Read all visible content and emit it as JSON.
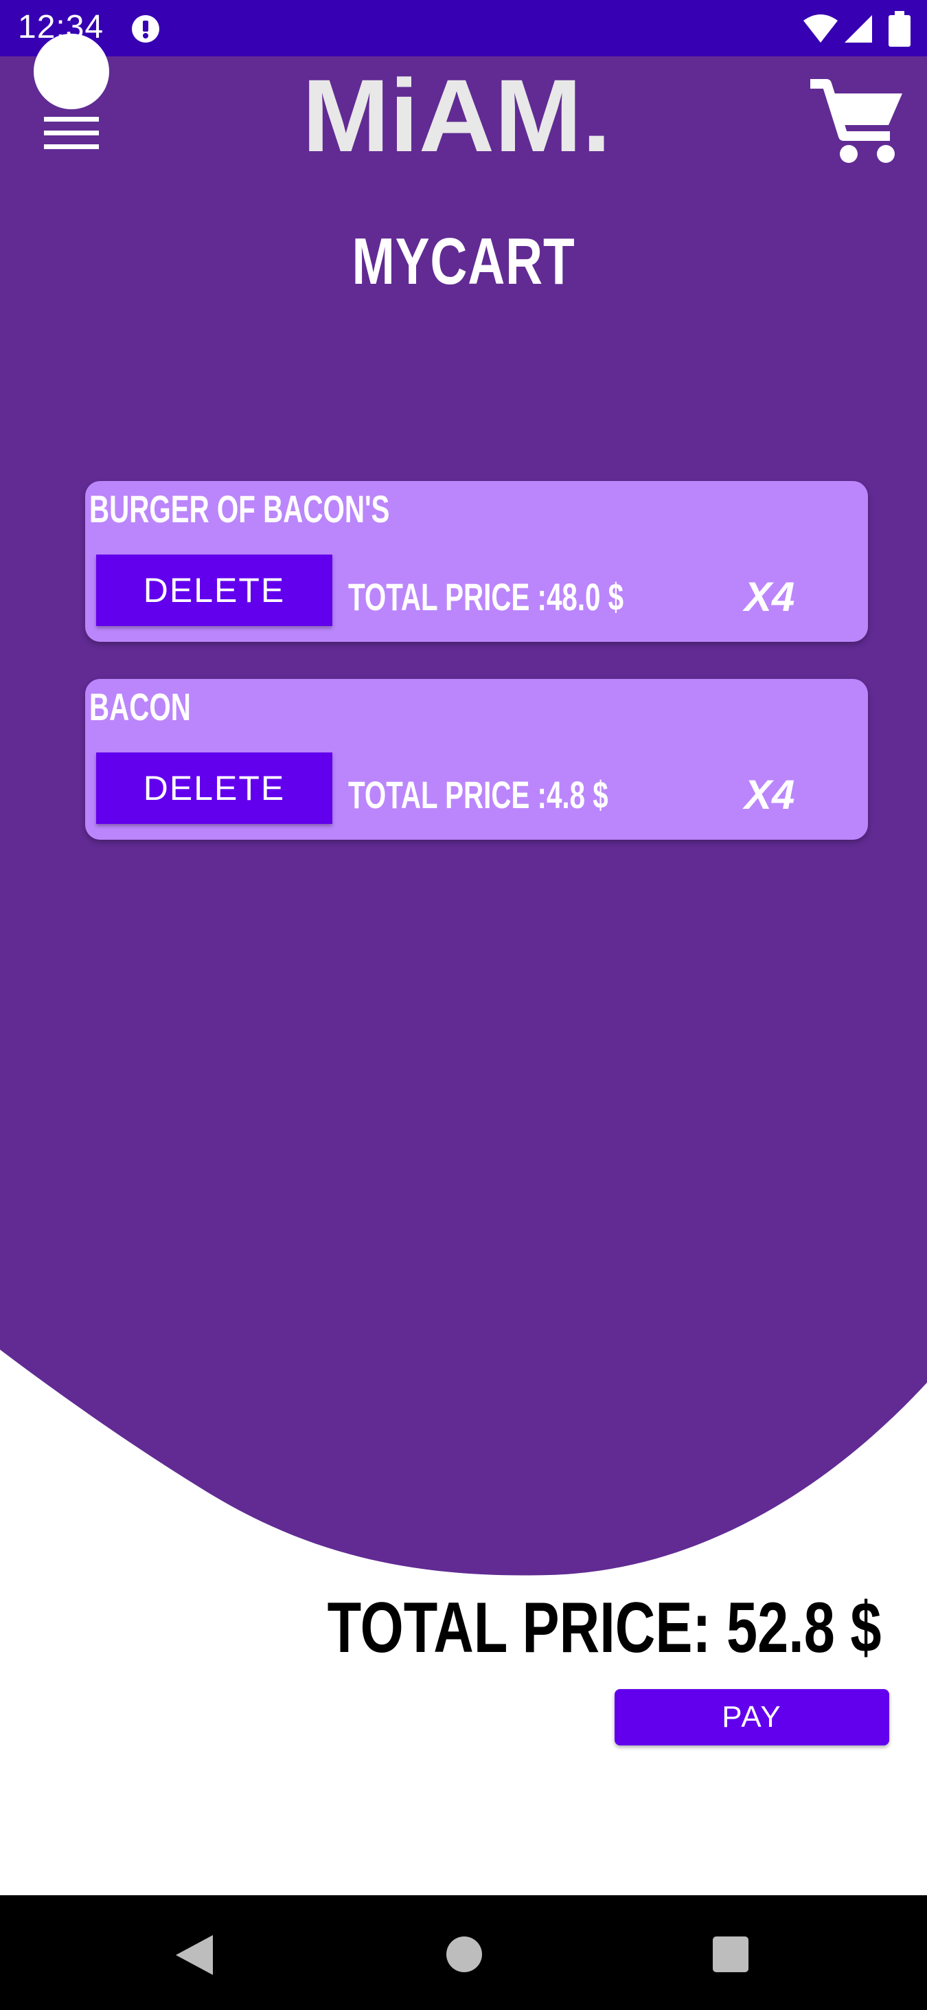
{
  "status_bar": {
    "time": "12:34",
    "alert_icon": "alert-circle-icon",
    "wifi_icon": "wifi-icon",
    "signal_icon": "cell-signal-icon",
    "battery_icon": "battery-icon"
  },
  "header": {
    "brand": "MiAM.",
    "menu_icon": "hamburger-menu-icon",
    "cart_icon": "shopping-cart-icon"
  },
  "page": {
    "title": "MYCART"
  },
  "cart_items": [
    {
      "name": "BURGER OF BACON'S",
      "delete_label": "DELETE",
      "total_text": "TOTAL PRICE :48.0 $",
      "quantity_text": "X4"
    },
    {
      "name": "BACON",
      "delete_label": "DELETE",
      "total_text": "TOTAL PRICE :4.8 $",
      "quantity_text": "X4"
    }
  ],
  "summary": {
    "total_text": "TOTAL PRICE: 52.8 $",
    "pay_label": "PAY"
  },
  "colors": {
    "status_bar": "#3700b3",
    "header_purple": "#612b93",
    "card": "#bb86fc",
    "button": "#6200ee",
    "nav_bar": "#000000"
  }
}
